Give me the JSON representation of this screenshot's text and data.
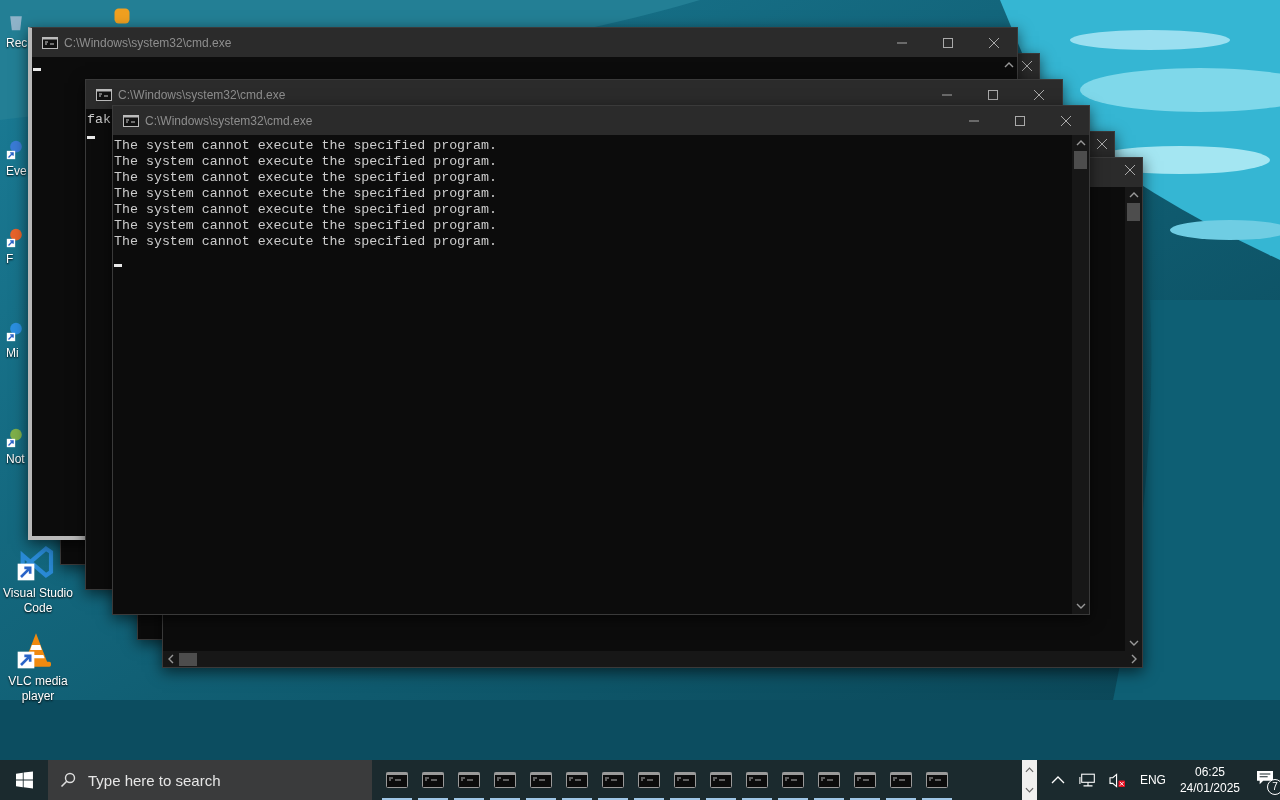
{
  "desktop_icons": [
    {
      "label": "Rec",
      "kind": "recycle"
    },
    {
      "kind": "app"
    },
    {
      "label": "Eve",
      "kind": "shortcut"
    },
    {
      "label": "F",
      "kind": "firefox"
    },
    {
      "label": "Mi",
      "kind": "edge"
    },
    {
      "label": "Not",
      "kind": "notepad"
    },
    {
      "label": "Visual Studio Code",
      "kind": "vscode"
    },
    {
      "label": "VLC media player",
      "kind": "vlc"
    }
  ],
  "windows": [
    {
      "kind": "frame"
    },
    {
      "kind": "console",
      "title": "C:\\Windows\\system32\\cmd.exe",
      "cursor": true
    },
    {
      "kind": "console",
      "title": "C:\\Windows\\system32\\cmd.exe",
      "lines": [
        "fak"
      ],
      "cursor": true
    },
    {
      "kind": "frame"
    },
    {
      "kind": "frame",
      "horizontal_scrollbar": true
    },
    {
      "kind": "console",
      "title": "C:\\Windows\\system32\\cmd.exe",
      "lines": [
        "The system cannot execute the specified program.",
        "The system cannot execute the specified program.",
        "The system cannot execute the specified program.",
        "The system cannot execute the specified program.",
        "The system cannot execute the specified program.",
        "The system cannot execute the specified program.",
        "The system cannot execute the specified program."
      ],
      "cursor": true
    }
  ],
  "taskbar": {
    "search": {
      "placeholder": "Type here to search"
    },
    "apps": [
      {
        "running": true
      },
      {
        "running": true
      },
      {
        "running": true
      },
      {
        "running": true
      },
      {
        "running": true
      },
      {
        "running": true
      },
      {
        "running": true
      },
      {
        "running": true
      },
      {
        "running": true
      },
      {
        "running": true
      },
      {
        "running": true
      },
      {
        "running": true
      },
      {
        "running": true
      },
      {
        "running": true
      },
      {
        "running": true
      },
      {
        "running": true
      }
    ],
    "language": "ENG",
    "time": "06:25",
    "date": "24/01/2025",
    "notifications": "7"
  }
}
